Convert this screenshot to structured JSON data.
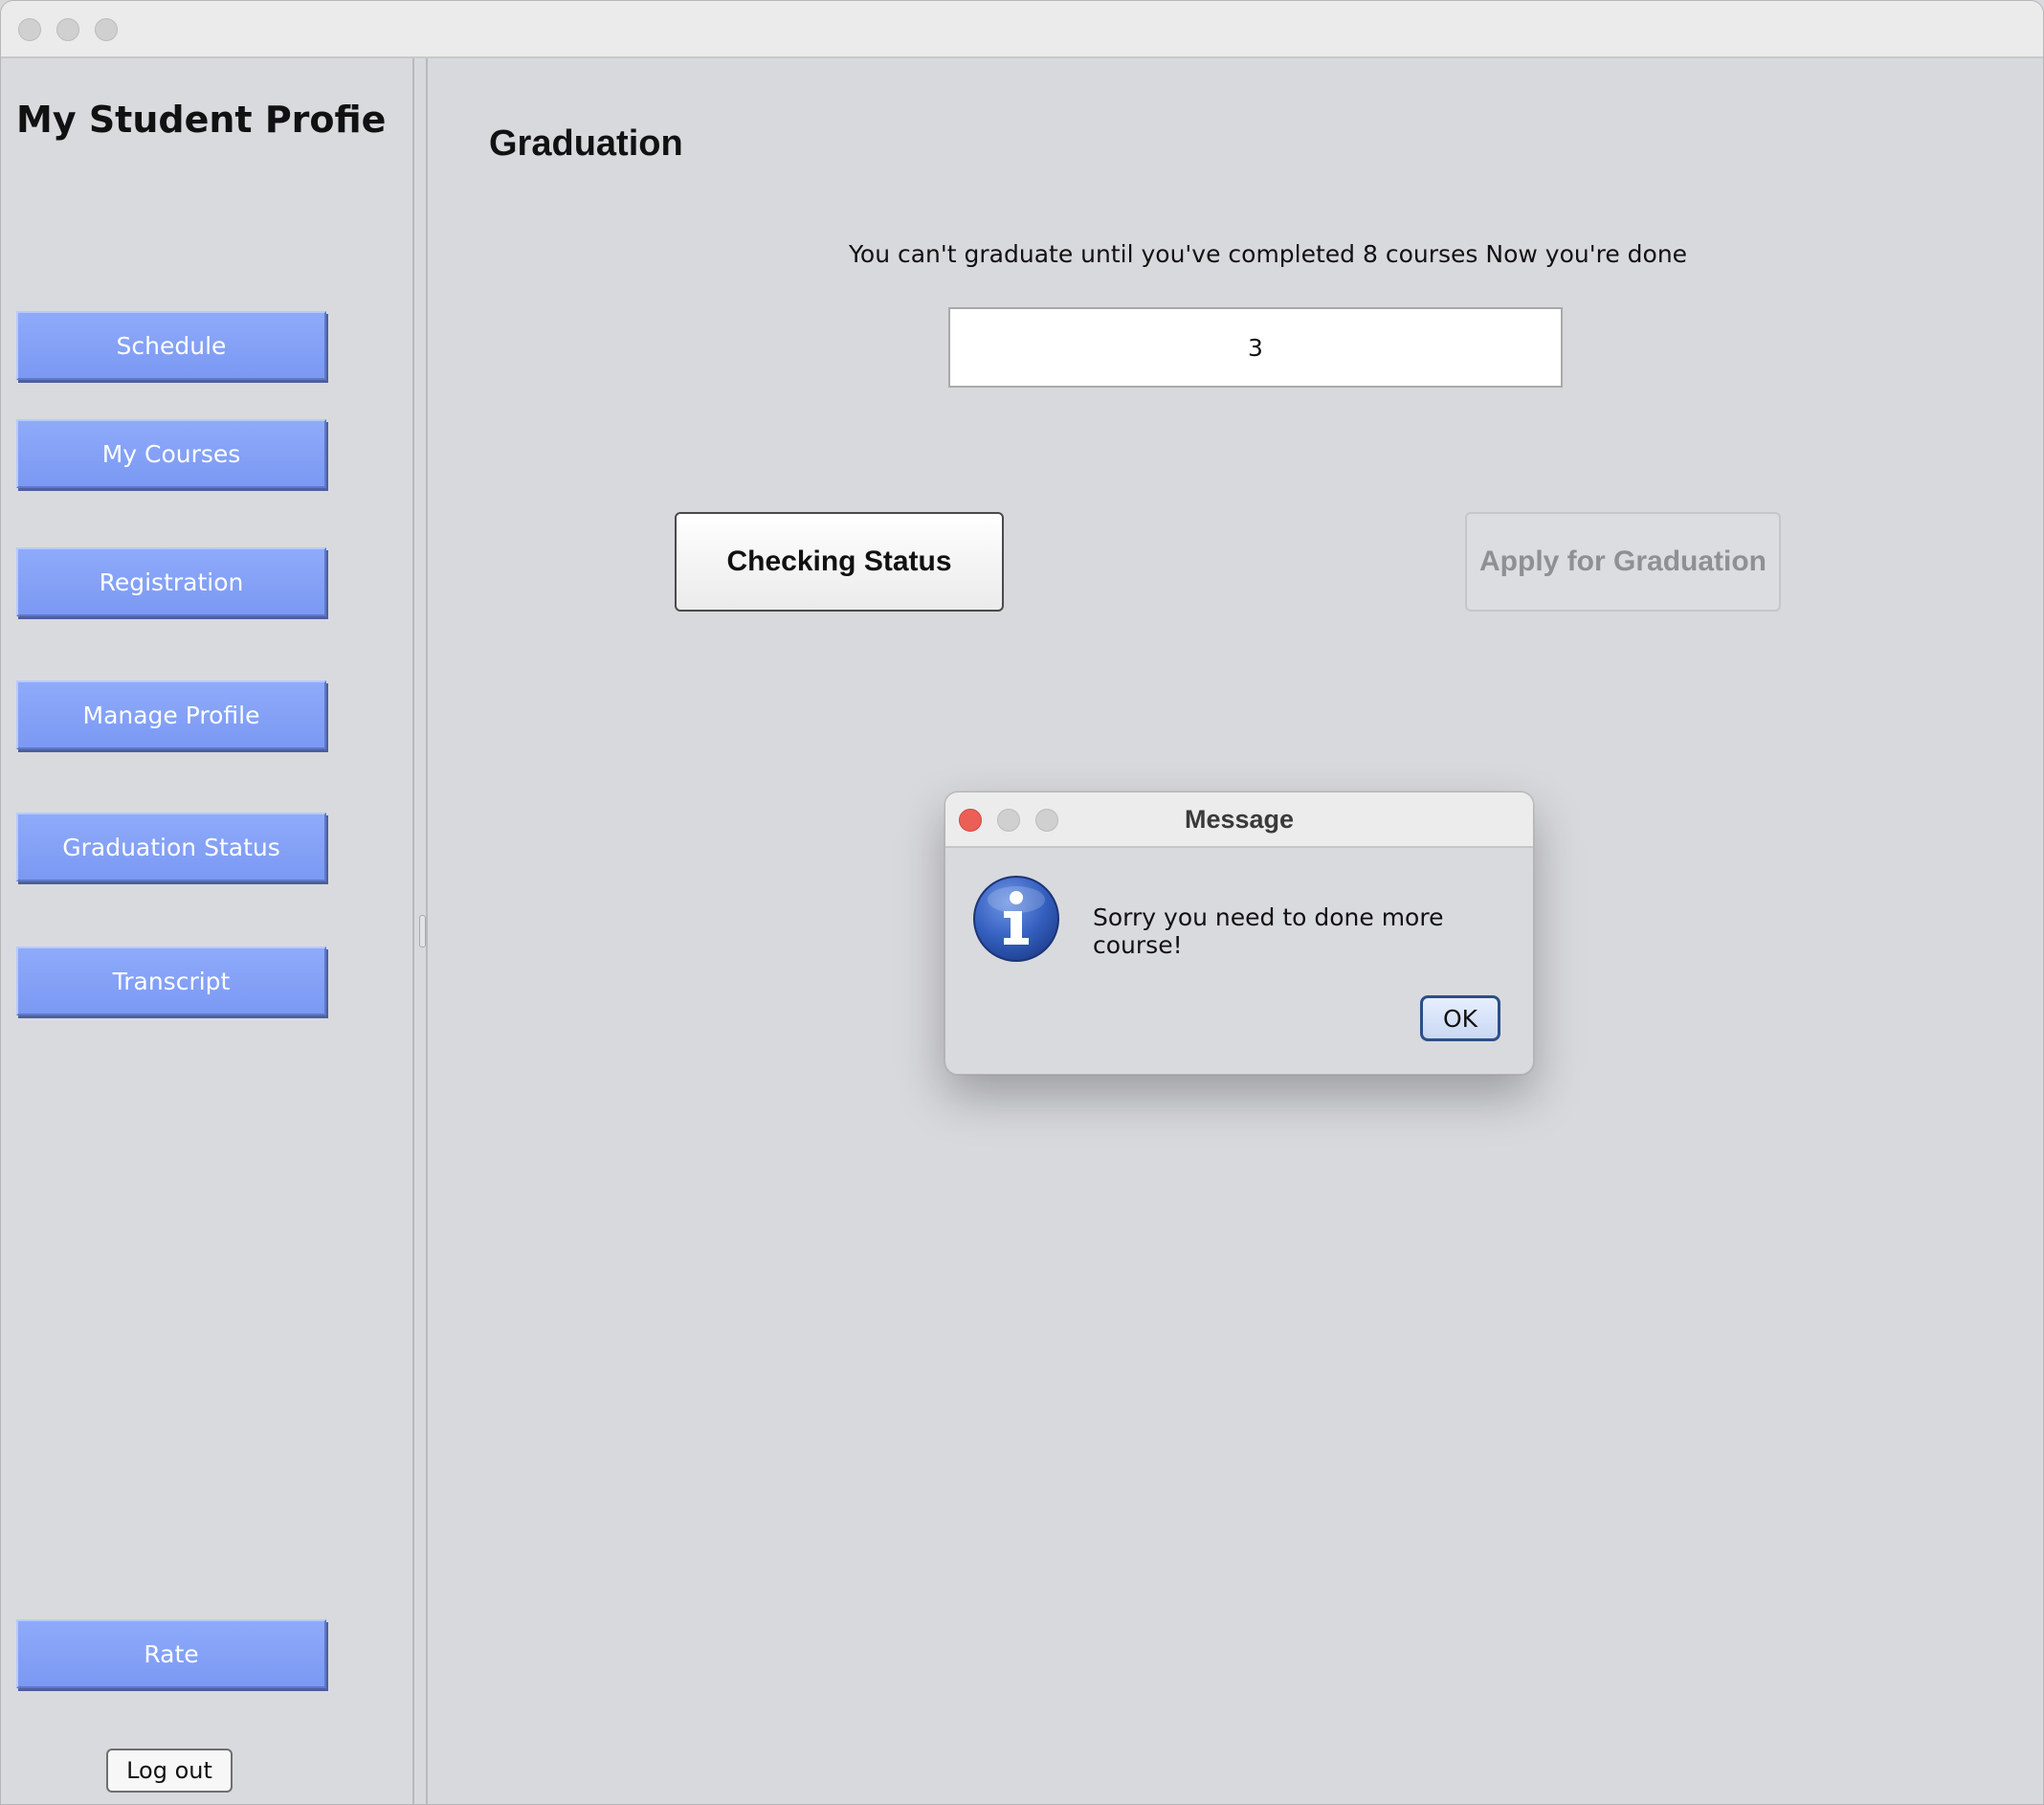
{
  "sidebar": {
    "title": "My Student Profie",
    "nav_buttons": [
      {
        "label": "Schedule"
      },
      {
        "label": "My Courses"
      },
      {
        "label": "Registration"
      },
      {
        "label": "Manage Profile"
      },
      {
        "label": "Graduation Status"
      },
      {
        "label": "Transcript"
      }
    ],
    "rate_label": "Rate",
    "logout_label": "Log out"
  },
  "main": {
    "title": "Graduation",
    "instruction": "You can't graduate until you've completed 8 courses Now you're done",
    "completed_courses_value": "3",
    "check_button_label": "Checking Status",
    "apply_button_label": "Apply for Graduation"
  },
  "dialog": {
    "title": "Message",
    "message": "Sorry you need to done more course!",
    "ok_label": "OK",
    "icon": "info-icon"
  },
  "colors": {
    "nav_button_blue": "#7f9cf5",
    "dialog_close_red": "#ec5f57",
    "info_icon_blue": "#2f58b1"
  }
}
